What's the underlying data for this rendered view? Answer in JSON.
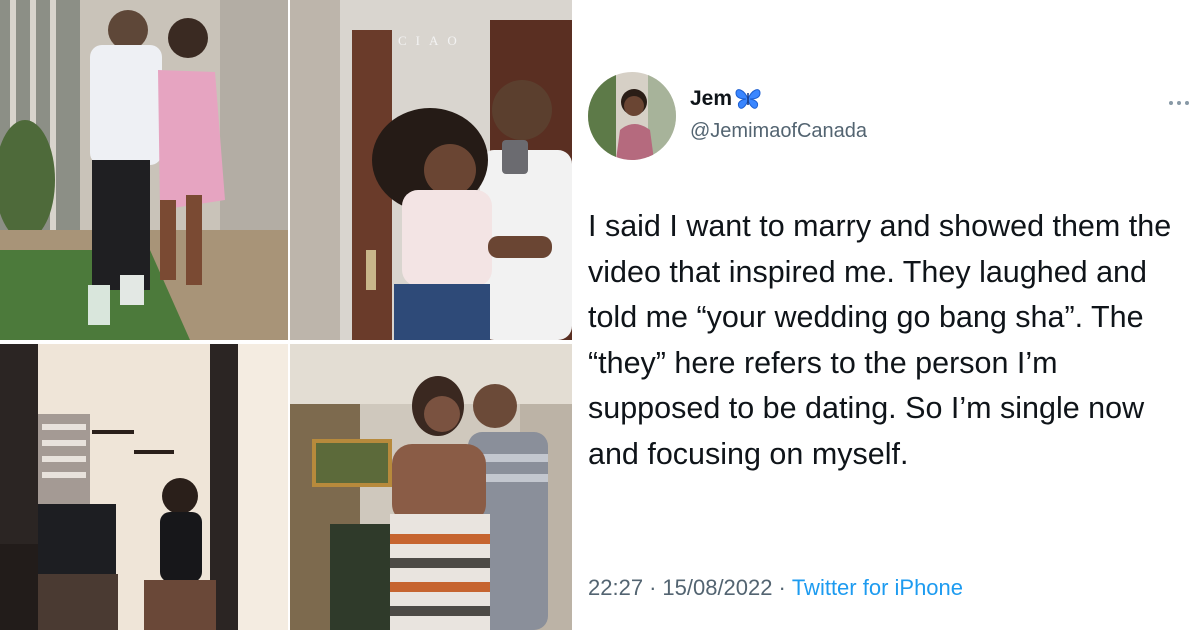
{
  "collage": {
    "photos": [
      {
        "name": "couple-outdoor-photo"
      },
      {
        "name": "couple-mirror-selfie-photo",
        "sign_text": "CIAO"
      },
      {
        "name": "woman-mirror-selfie-photo"
      },
      {
        "name": "couple-hug-photo"
      }
    ]
  },
  "tweet": {
    "display_name": "Jem",
    "badge_icon": "butterfly-icon",
    "handle": "@JemimaofCanada",
    "text": "I said I want to marry and showed them the video that inspired me. They laughed and told me “your wedding go bang sha”. The “they” here refers to the person I’m supposed to be dating. So I’m single now and focusing on myself.",
    "time": "22:27",
    "date": "15/08/2022",
    "separator": "·",
    "source": "Twitter for iPhone",
    "colors": {
      "text": "#0f1419",
      "secondary": "#536471",
      "link": "#1d9bf0"
    }
  }
}
